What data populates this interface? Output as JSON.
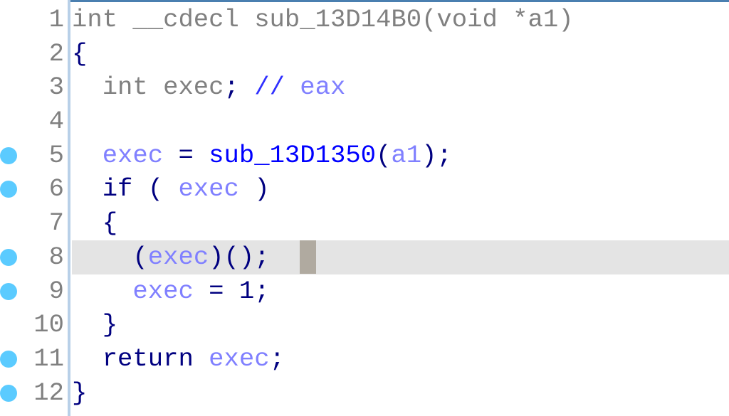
{
  "colors": {
    "breakpoint": "#5bcbff",
    "highlight": "#e4e4e4",
    "variable": "#8080ff",
    "function": "#0000ff",
    "punct": "#000080",
    "declaration": "#808080"
  },
  "cursor_line": 8,
  "lines": [
    {
      "num": "1",
      "bp": false,
      "tokens": [
        {
          "t": "int __cdecl sub_13D14B0(void *a1)",
          "c": "gray"
        }
      ]
    },
    {
      "num": "2",
      "bp": false,
      "tokens": [
        {
          "t": "{",
          "c": "punct"
        }
      ]
    },
    {
      "num": "3",
      "bp": false,
      "tokens": [
        {
          "t": "  int exec",
          "c": "gray"
        },
        {
          "t": "; ",
          "c": "punct"
        },
        {
          "t": "// ",
          "c": "cmt"
        },
        {
          "t": "eax",
          "c": "var"
        }
      ]
    },
    {
      "num": "4",
      "bp": false,
      "tokens": []
    },
    {
      "num": "5",
      "bp": true,
      "tokens": [
        {
          "t": "  exec",
          "c": "var"
        },
        {
          "t": " = ",
          "c": "punct"
        },
        {
          "t": "sub_13D1350",
          "c": "func"
        },
        {
          "t": "(",
          "c": "punct"
        },
        {
          "t": "a1",
          "c": "var"
        },
        {
          "t": ");",
          "c": "punct"
        }
      ]
    },
    {
      "num": "6",
      "bp": true,
      "tokens": [
        {
          "t": "  if ( ",
          "c": "kw"
        },
        {
          "t": "exec",
          "c": "var"
        },
        {
          "t": " )",
          "c": "punct"
        }
      ]
    },
    {
      "num": "7",
      "bp": false,
      "tokens": [
        {
          "t": "  {",
          "c": "punct"
        }
      ]
    },
    {
      "num": "8",
      "bp": true,
      "tokens": [
        {
          "t": "    (",
          "c": "punct"
        },
        {
          "t": "exec",
          "c": "var"
        },
        {
          "t": ")();  ",
          "c": "punct"
        }
      ]
    },
    {
      "num": "9",
      "bp": true,
      "tokens": [
        {
          "t": "    exec",
          "c": "var"
        },
        {
          "t": " = 1;",
          "c": "punct"
        }
      ]
    },
    {
      "num": "10",
      "bp": false,
      "tokens": [
        {
          "t": "  }",
          "c": "punct"
        }
      ]
    },
    {
      "num": "11",
      "bp": true,
      "tokens": [
        {
          "t": "  return ",
          "c": "kw"
        },
        {
          "t": "exec",
          "c": "var"
        },
        {
          "t": ";",
          "c": "punct"
        }
      ]
    },
    {
      "num": "12",
      "bp": true,
      "tokens": [
        {
          "t": "}",
          "c": "punct"
        }
      ]
    }
  ]
}
